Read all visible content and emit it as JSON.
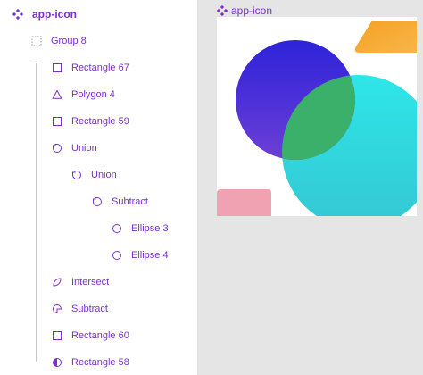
{
  "layers_panel": {
    "root": {
      "label": "app-icon",
      "icon": "component-icon"
    },
    "items": [
      {
        "label": "Group 8",
        "icon": "group-icon"
      },
      {
        "label": "Rectangle 67",
        "icon": "rectangle-icon"
      },
      {
        "label": "Polygon 4",
        "icon": "polygon-icon"
      },
      {
        "label": "Rectangle 59",
        "icon": "rectangle-icon"
      },
      {
        "label": "Union",
        "icon": "union-icon"
      },
      {
        "label": "Union",
        "icon": "union-icon"
      },
      {
        "label": "Subtract",
        "icon": "subtract-icon"
      },
      {
        "label": "Ellipse 3",
        "icon": "ellipse-icon"
      },
      {
        "label": "Ellipse 4",
        "icon": "ellipse-icon"
      },
      {
        "label": "Intersect",
        "icon": "intersect-icon"
      },
      {
        "label": "Subtract",
        "icon": "subtract-icon"
      },
      {
        "label": "Rectangle 60",
        "icon": "rectangle-icon"
      },
      {
        "label": "Rectangle 58",
        "icon": "half-circle-icon"
      }
    ]
  },
  "canvas": {
    "frame_title": "app-icon",
    "colors": {
      "accent": "#7b2fcd",
      "blue_circle": "#3a2ed6",
      "cyan_circle": "#2ee0e0",
      "overlap": "#3bb06a",
      "orange_shape": "#f7a531",
      "pink_rect": "#f0a1b2"
    }
  }
}
